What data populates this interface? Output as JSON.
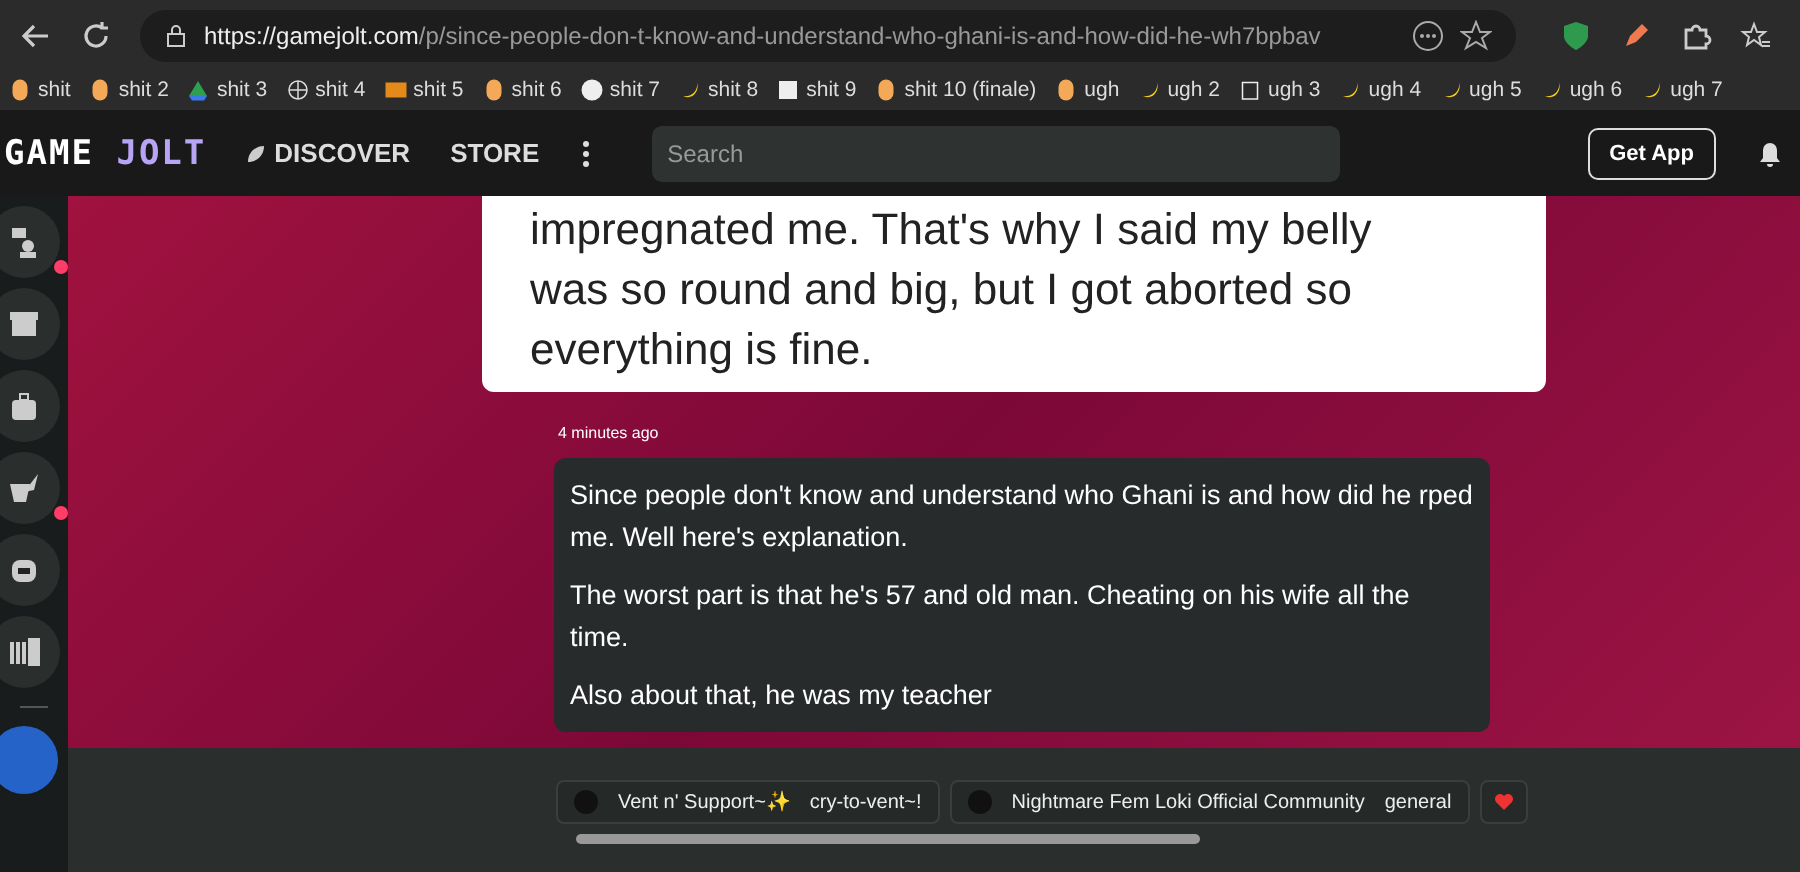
{
  "browser": {
    "url_host": "https://gamejolt.com",
    "url_path": "/p/since-people-don-t-know-and-understand-who-ghani-is-and-how-did-he-wh7bpbav",
    "bookmarks": [
      {
        "label": "shit",
        "kind": "coin"
      },
      {
        "label": "shit 2",
        "kind": "coin"
      },
      {
        "label": "shit 3",
        "kind": "drive"
      },
      {
        "label": "shit 4",
        "kind": "globe"
      },
      {
        "label": "shit 5",
        "kind": "ng"
      },
      {
        "label": "shit 6",
        "kind": "coin"
      },
      {
        "label": "shit 7",
        "kind": "github"
      },
      {
        "label": "shit 8",
        "kind": "banana"
      },
      {
        "label": "shit 9",
        "kind": "p"
      },
      {
        "label": "shit 10 (finale)",
        "kind": "coin"
      },
      {
        "label": "ugh",
        "kind": "coin"
      },
      {
        "label": "ugh 2",
        "kind": "banana"
      },
      {
        "label": "ugh 3",
        "kind": "trash"
      },
      {
        "label": "ugh 4",
        "kind": "banana"
      },
      {
        "label": "ugh 5",
        "kind": "banana"
      },
      {
        "label": "ugh 6",
        "kind": "banana"
      },
      {
        "label": "ugh 7",
        "kind": "banana"
      }
    ]
  },
  "header": {
    "logo_left": "GAME",
    "logo_right": "JOLT",
    "nav": [
      "DISCOVER",
      "STORE"
    ],
    "search": {
      "placeholder": "Search"
    },
    "get_app": "Get App"
  },
  "sidebar": {
    "items": [
      {
        "kind": "chat",
        "unread": true
      },
      {
        "kind": "store",
        "unread": false
      },
      {
        "kind": "bag",
        "unread": false
      },
      {
        "kind": "quill",
        "unread": true
      },
      {
        "kind": "robot",
        "unread": false
      },
      {
        "kind": "library",
        "unread": false
      }
    ]
  },
  "post": {
    "previous_text": [
      "impregnated me. That's why I said my belly",
      "was so round and big, but I got aborted so",
      "everything is fine."
    ],
    "time": "4 minutes ago",
    "paragraphs": [
      "Since people don't know and understand who Ghani is and how did he rped me. Well here's explanation.",
      "The worst part is that he's 57 and old man. Cheating on his wife all the time.",
      "Also about that, he was my teacher"
    ]
  },
  "communities": [
    {
      "name": "Vent n' Support~✨",
      "channel": "cry-to-vent~!"
    },
    {
      "name": "Nightmare Fem Loki Official Community",
      "channel": "general"
    }
  ]
}
